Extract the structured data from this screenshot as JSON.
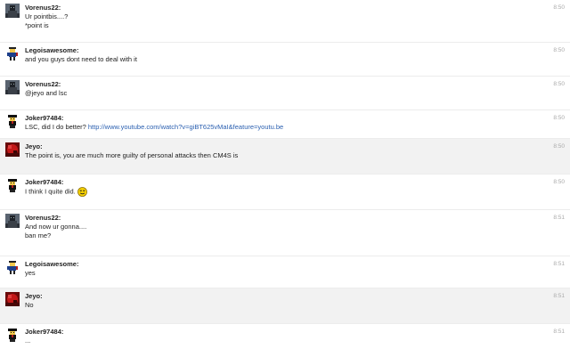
{
  "messages": [
    {
      "author": "Vorenus22:",
      "time": "8:50",
      "avatar": "vorenus-avatar",
      "lines": [
        "Ur pointbis....?",
        "*point is"
      ]
    },
    {
      "author": "Legoisawesome:",
      "time": "8:50",
      "avatar": "lego-avatar",
      "lines": [
        "and you guys dont need to deal with it"
      ]
    },
    {
      "author": "Vorenus22:",
      "time": "8:50",
      "avatar": "vorenus-avatar",
      "lines": [
        "@jeyo and lsc"
      ]
    },
    {
      "author": "Joker97484:",
      "time": "8:50",
      "avatar": "joker-avatar",
      "lines": [
        "LSC, did I do better? "
      ],
      "link": "http://www.youtube.com/watch?v=giBT625vMaI&feature=youtu.be"
    },
    {
      "author": "Jeyo:",
      "time": "8:50",
      "avatar": "jeyo-avatar",
      "highlighted": true,
      "lines": [
        "The point is, you are much more guilty of personal attacks then CM4S is"
      ]
    },
    {
      "author": "Joker97484:",
      "time": "8:50",
      "avatar": "joker-avatar",
      "lines": [
        "I think I quite did."
      ],
      "emoji": "smiley-emoji-icon"
    },
    {
      "author": "Vorenus22:",
      "time": "8:51",
      "avatar": "vorenus-avatar",
      "lines": [
        "And now ur gonna....",
        "ban me?"
      ]
    },
    {
      "author": "Legoisawesome:",
      "time": "8:51",
      "avatar": "lego-avatar",
      "lines": [
        "yes"
      ]
    },
    {
      "author": "Jeyo:",
      "time": "8:51",
      "avatar": "jeyo-avatar",
      "highlighted": true,
      "lines": [
        "No"
      ]
    },
    {
      "author": "Joker97484:",
      "time": "8:51",
      "avatar": "joker-avatar",
      "lines": [
        "..."
      ]
    }
  ]
}
